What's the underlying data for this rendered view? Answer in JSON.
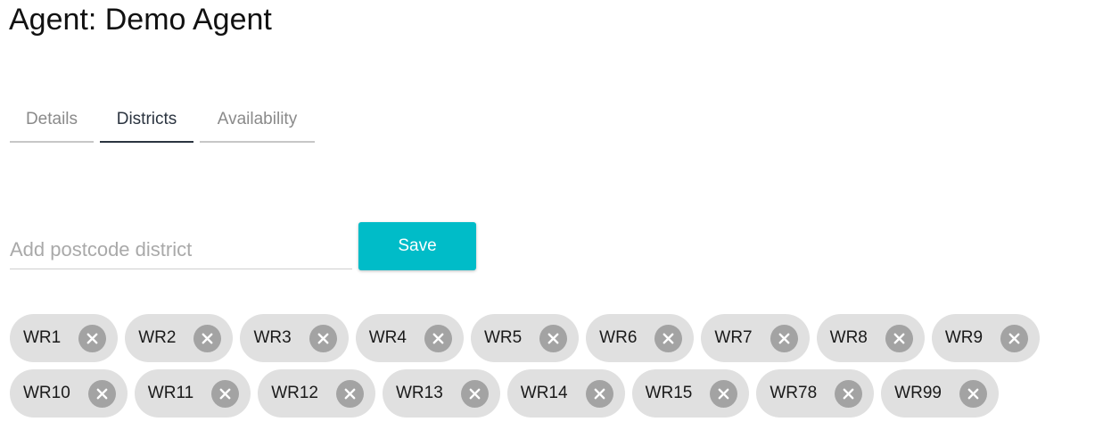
{
  "page": {
    "title": "Agent: Demo Agent"
  },
  "tabs": [
    {
      "label": "Details",
      "active": false
    },
    {
      "label": "Districts",
      "active": true
    },
    {
      "label": "Availability",
      "active": false
    }
  ],
  "district_form": {
    "input_value": "",
    "input_placeholder": "Add postcode district",
    "save_label": "Save"
  },
  "colors": {
    "accent": "#00bcc8",
    "chip_background": "#e0e0e0",
    "chip_remove_icon_background": "#a3a3a3",
    "active_tab": "#2b3440"
  },
  "districts": [
    {
      "label": "WR1",
      "remove_icon": "close-circle-icon"
    },
    {
      "label": "WR2",
      "remove_icon": "close-circle-icon"
    },
    {
      "label": "WR3",
      "remove_icon": "close-circle-icon"
    },
    {
      "label": "WR4",
      "remove_icon": "close-circle-icon"
    },
    {
      "label": "WR5",
      "remove_icon": "close-circle-icon"
    },
    {
      "label": "WR6",
      "remove_icon": "close-circle-icon"
    },
    {
      "label": "WR7",
      "remove_icon": "close-circle-icon"
    },
    {
      "label": "WR8",
      "remove_icon": "close-circle-icon"
    },
    {
      "label": "WR9",
      "remove_icon": "close-circle-icon"
    },
    {
      "label": "WR10",
      "remove_icon": "close-circle-icon"
    },
    {
      "label": "WR11",
      "remove_icon": "close-circle-icon"
    },
    {
      "label": "WR12",
      "remove_icon": "close-circle-icon"
    },
    {
      "label": "WR13",
      "remove_icon": "close-circle-icon"
    },
    {
      "label": "WR14",
      "remove_icon": "close-circle-icon"
    },
    {
      "label": "WR15",
      "remove_icon": "close-circle-icon"
    },
    {
      "label": "WR78",
      "remove_icon": "close-circle-icon"
    },
    {
      "label": "WR99",
      "remove_icon": "close-circle-icon"
    }
  ]
}
